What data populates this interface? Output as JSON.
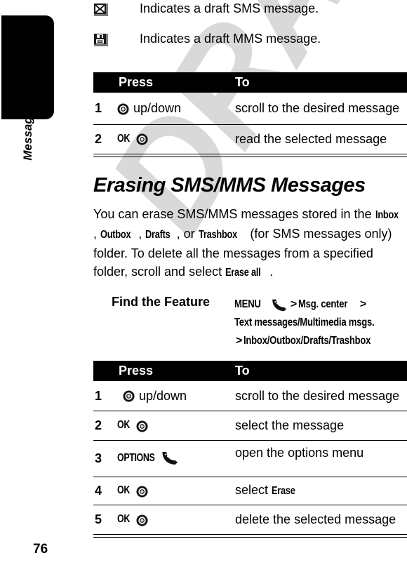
{
  "page": {
    "number": "76",
    "chapter_tab_label": "Messages",
    "watermark_text": "DRAFT"
  },
  "legend": [
    {
      "icon": "draft-sms-envelope-icon",
      "text": "Indicates a draft SMS message."
    },
    {
      "icon": "draft-mms-floppy-icon",
      "text": "Indicates a draft MMS message."
    }
  ],
  "table_top": {
    "headers": {
      "num": "",
      "press": "Press",
      "to": "To"
    },
    "rows": [
      {
        "num": "1",
        "press_icon": "nav-key-icon",
        "press_key": "",
        "press_suffix": "up/down",
        "to": "scroll to the desired message"
      },
      {
        "num": "2",
        "press_icon": "center-select-key-icon",
        "press_key": "OK",
        "press_suffix": "",
        "to": "read the selected message"
      }
    ]
  },
  "section": {
    "title": "Erasing SMS/MMS Messages",
    "paragraph": {
      "p1": "You can erase SMS/MMS messages stored in the ",
      "b1": "Inbox",
      "p2": ", ",
      "b2": "Outbox",
      "p3": ", ",
      "b3": "Drafts",
      "p4": ", or ",
      "b4": "Trashbox",
      "p5": " (for SMS messages only) folder. To delete all the messages from a specified folder, scroll and select ",
      "b5": "Erase all",
      "p6": "."
    }
  },
  "find_the_feature": {
    "label": "Find the Feature",
    "menu_key": "MENU",
    "menu_icon": "softkey-menu-icon",
    "sep1": ">",
    "item1": "Msg. center",
    "sep2": ">",
    "item2": "Text messages/Multimedia msgs.",
    "sep3": ">",
    "item3": "Inbox/Outbox/Drafts/Trashbox"
  },
  "table_bottom": {
    "headers": {
      "num": "",
      "press": "Press",
      "to": "To"
    },
    "rows": [
      {
        "num": "1",
        "press_icon": "nav-key-icon",
        "press_key": "",
        "press_suffix": "up/down",
        "to": "scroll to the desired message"
      },
      {
        "num": "2",
        "press_icon": "center-select-key-icon",
        "press_key": "OK",
        "press_suffix": "",
        "to": "select the message"
      },
      {
        "num": "3",
        "press_icon": "softkey-menu-icon",
        "press_key": "OPTIONS",
        "press_suffix": "",
        "to": "open the options menu"
      },
      {
        "num": "4",
        "press_icon": "center-select-key-icon",
        "press_key": "OK",
        "press_suffix": "",
        "to_plain": "select ",
        "to_bold": "Erase",
        "to": ""
      },
      {
        "num": "5",
        "press_icon": "center-select-key-icon",
        "press_key": "OK",
        "press_suffix": "",
        "to": "delete the selected message"
      }
    ]
  },
  "colors": {
    "ink": "#000000",
    "paper": "#ffffff",
    "watermark": "#d9d9d9"
  }
}
